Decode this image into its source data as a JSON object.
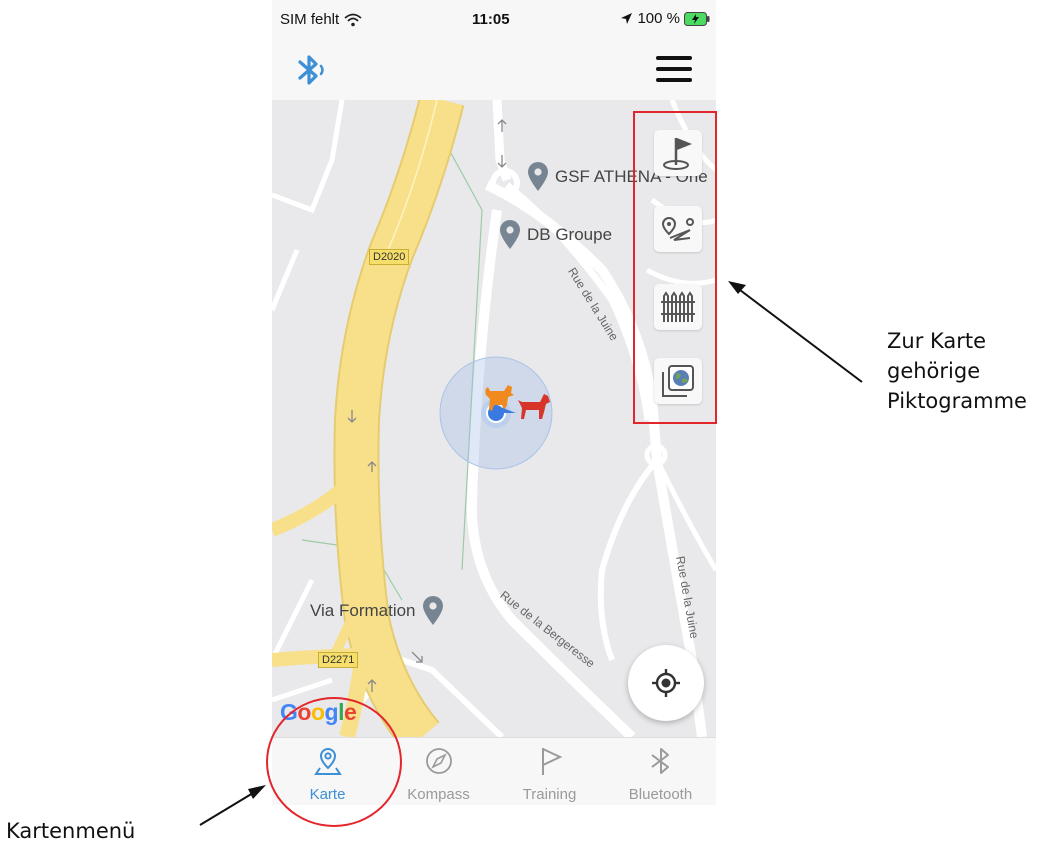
{
  "status_bar": {
    "carrier": "SIM fehlt",
    "time": "11:05",
    "battery": "100 %"
  },
  "app_bar": {
    "left_icon": "bluetooth-icon",
    "right_icon": "menu-icon"
  },
  "map": {
    "pois": [
      {
        "name": "GSF ATHENA - Orle"
      },
      {
        "name": "DB Groupe"
      },
      {
        "name": "Via Formation"
      }
    ],
    "road_labels": [
      {
        "text": "Rue de la Juine"
      },
      {
        "text": "Rue de la Bergeresse"
      },
      {
        "text": "Rue de la Juine"
      }
    ],
    "road_shields": [
      {
        "text": "D2020"
      },
      {
        "text": "D2271"
      }
    ],
    "tools": [
      {
        "icon": "flag-location-icon"
      },
      {
        "icon": "route-icon"
      },
      {
        "icon": "fence-icon"
      },
      {
        "icon": "map-layers-icon"
      }
    ],
    "google_logo": "Google"
  },
  "tabs": [
    {
      "label": "Karte",
      "icon": "map-pin-icon",
      "active": true
    },
    {
      "label": "Kompass",
      "icon": "compass-icon",
      "active": false
    },
    {
      "label": "Training",
      "icon": "flag-icon",
      "active": false
    },
    {
      "label": "Bluetooth",
      "icon": "bluetooth-icon",
      "active": false
    }
  ],
  "annotations": {
    "pictograms_line1": "Zur Karte",
    "pictograms_line2": "gehörige",
    "pictograms_line3": "Piktogramme",
    "menu_label": "Kartenmenü"
  },
  "colors": {
    "accent": "#3d8fd6",
    "annotation_red": "#e3262b",
    "highway_yellow": "#f8e08a",
    "map_background": "#e9e9ec"
  }
}
